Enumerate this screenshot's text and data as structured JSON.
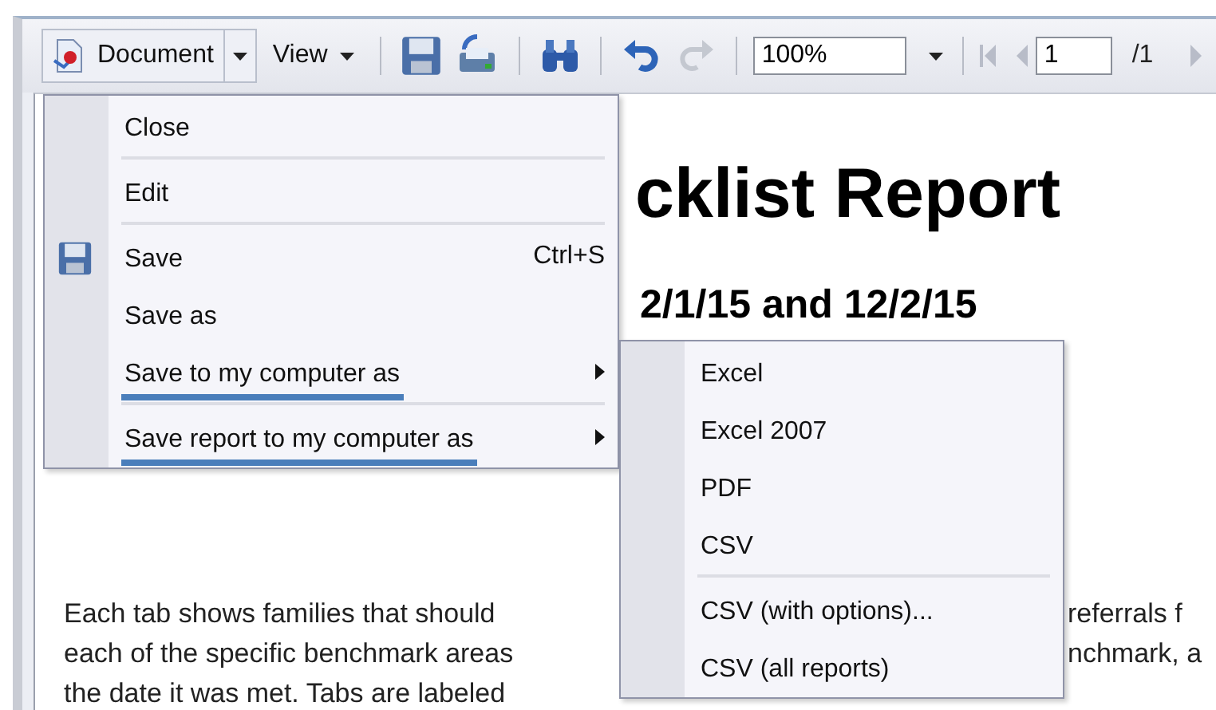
{
  "toolbar": {
    "document_button": "Document",
    "view_button": "View",
    "zoom": "100%",
    "page": "1",
    "page_total": "/1"
  },
  "report": {
    "title": "cklist Report",
    "subtitle": "2/1/15 and 12/2/15",
    "lines": [
      {
        "left": "Each tab shows families that should",
        "right": "referrals f"
      },
      {
        "left": "each of the specific benchmark areas",
        "right": "nchmark, a"
      },
      {
        "left": "the date it was met. Tabs are labeled"
      }
    ]
  },
  "document_menu": {
    "items": [
      {
        "kind": "item",
        "label": "Close",
        "has_icon": false,
        "submenu": false,
        "highlighted": false
      },
      {
        "kind": "separator"
      },
      {
        "kind": "item",
        "label": "Edit",
        "has_icon": false,
        "submenu": false,
        "highlighted": false
      },
      {
        "kind": "separator"
      },
      {
        "kind": "item",
        "label": "Save",
        "shortcut": "Ctrl+S",
        "has_icon": true,
        "submenu": false,
        "highlighted": false
      },
      {
        "kind": "item",
        "label": "Save as",
        "has_icon": false,
        "submenu": false,
        "highlighted": false
      },
      {
        "kind": "item",
        "label": "Save to my computer as",
        "has_icon": false,
        "submenu": true,
        "highlighted": true
      },
      {
        "kind": "separator"
      },
      {
        "kind": "item",
        "label": "Save report to my computer as",
        "has_icon": false,
        "submenu": true,
        "highlighted": true
      }
    ]
  },
  "export_menu": {
    "items": [
      {
        "kind": "item",
        "label": "Excel",
        "has_icon": false,
        "submenu": false,
        "highlighted": false
      },
      {
        "kind": "item",
        "label": "Excel 2007",
        "has_icon": false,
        "submenu": false,
        "highlighted": false
      },
      {
        "kind": "item",
        "label": "PDF",
        "has_icon": false,
        "submenu": false,
        "highlighted": false
      },
      {
        "kind": "item",
        "label": "CSV",
        "has_icon": false,
        "submenu": false,
        "highlighted": false
      },
      {
        "kind": "separator"
      },
      {
        "kind": "item",
        "label": "CSV (with options)...",
        "has_icon": false,
        "submenu": false,
        "highlighted": false
      },
      {
        "kind": "item",
        "label": "CSV (all reports)",
        "has_icon": false,
        "submenu": false,
        "highlighted": false
      }
    ]
  }
}
